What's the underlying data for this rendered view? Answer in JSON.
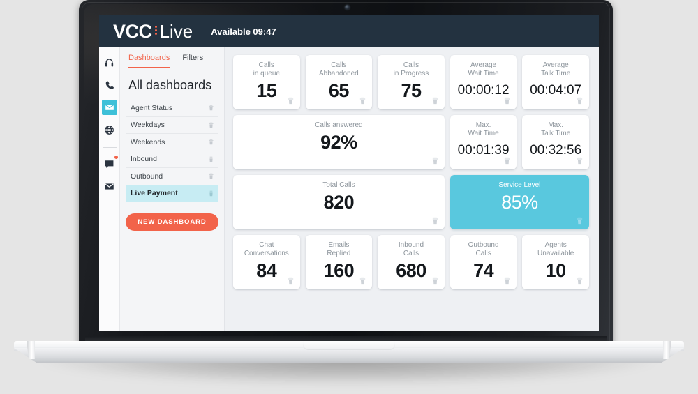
{
  "app": {
    "logo_primary": "VCC",
    "logo_secondary": "Live",
    "status": "Available 09:47"
  },
  "rail": {
    "items": [
      {
        "name": "headset-icon",
        "active": false
      },
      {
        "name": "phone-icon",
        "active": false
      },
      {
        "name": "envelope-icon",
        "active": true
      },
      {
        "name": "globe-icon",
        "active": false
      },
      {
        "name": "chat-icon",
        "active": false,
        "badge": true
      },
      {
        "name": "mail-icon",
        "active": false
      }
    ]
  },
  "sidebar": {
    "tabs": [
      {
        "label": "Dashboards",
        "active": true
      },
      {
        "label": "Filters",
        "active": false
      }
    ],
    "title": "All dashboards",
    "dashboards": [
      {
        "label": "Agent Status",
        "selected": false
      },
      {
        "label": "Weekdays",
        "selected": false
      },
      {
        "label": "Weekends",
        "selected": false
      },
      {
        "label": "Inbound",
        "selected": false
      },
      {
        "label": "Outbound",
        "selected": false
      },
      {
        "label": "Live Payment",
        "selected": true
      }
    ],
    "new_dashboard_label": "NEW DASHBOARD"
  },
  "main": {
    "tiles": [
      {
        "label": "Calls\nin queue",
        "value": "15",
        "span": 1,
        "accent": false,
        "time": false
      },
      {
        "label": "Calls\nAbbandoned",
        "value": "65",
        "span": 1,
        "accent": false,
        "time": false
      },
      {
        "label": "Calls\nin Progress",
        "value": "75",
        "span": 1,
        "accent": false,
        "time": false
      },
      {
        "label": "Average\nWait Time",
        "value": "00:00:12",
        "span": 1,
        "accent": false,
        "time": true
      },
      {
        "label": "Average\nTalk Time",
        "value": "00:04:07",
        "span": 1,
        "accent": false,
        "time": true
      },
      {
        "label": "Calls answered",
        "value": "92%",
        "span": 3,
        "accent": false,
        "time": false
      },
      {
        "label": "Max.\nWait Time",
        "value": "00:01:39",
        "span": 1,
        "accent": false,
        "time": true
      },
      {
        "label": "Max.\nTalk Time",
        "value": "00:32:56",
        "span": 1,
        "accent": false,
        "time": true
      },
      {
        "label": "Total Calls",
        "value": "820",
        "span": 3,
        "accent": false,
        "time": false
      },
      {
        "label": "Service Level",
        "value": "85%",
        "span": 2,
        "accent": true,
        "time": false
      },
      {
        "label": "Chat\nConversations",
        "value": "84",
        "span": 1,
        "accent": false,
        "time": false
      },
      {
        "label": "Emails\nReplied",
        "value": "160",
        "span": 1,
        "accent": false,
        "time": false
      },
      {
        "label": "Inbound\nCalls",
        "value": "680",
        "span": 1,
        "accent": false,
        "time": false
      },
      {
        "label": "Outbound\nCalls",
        "value": "74",
        "span": 1,
        "accent": false,
        "time": false
      },
      {
        "label": "Agents\nUnavailable",
        "value": "10",
        "span": 1,
        "accent": false,
        "time": false
      }
    ],
    "delete_icon": "trash-icon"
  },
  "colors": {
    "header_bg": "#233240",
    "accent_coral": "#f2634a",
    "accent_teal": "#59c8de",
    "selected_row": "#c7ecf3",
    "page_bg": "#eef0f3"
  }
}
